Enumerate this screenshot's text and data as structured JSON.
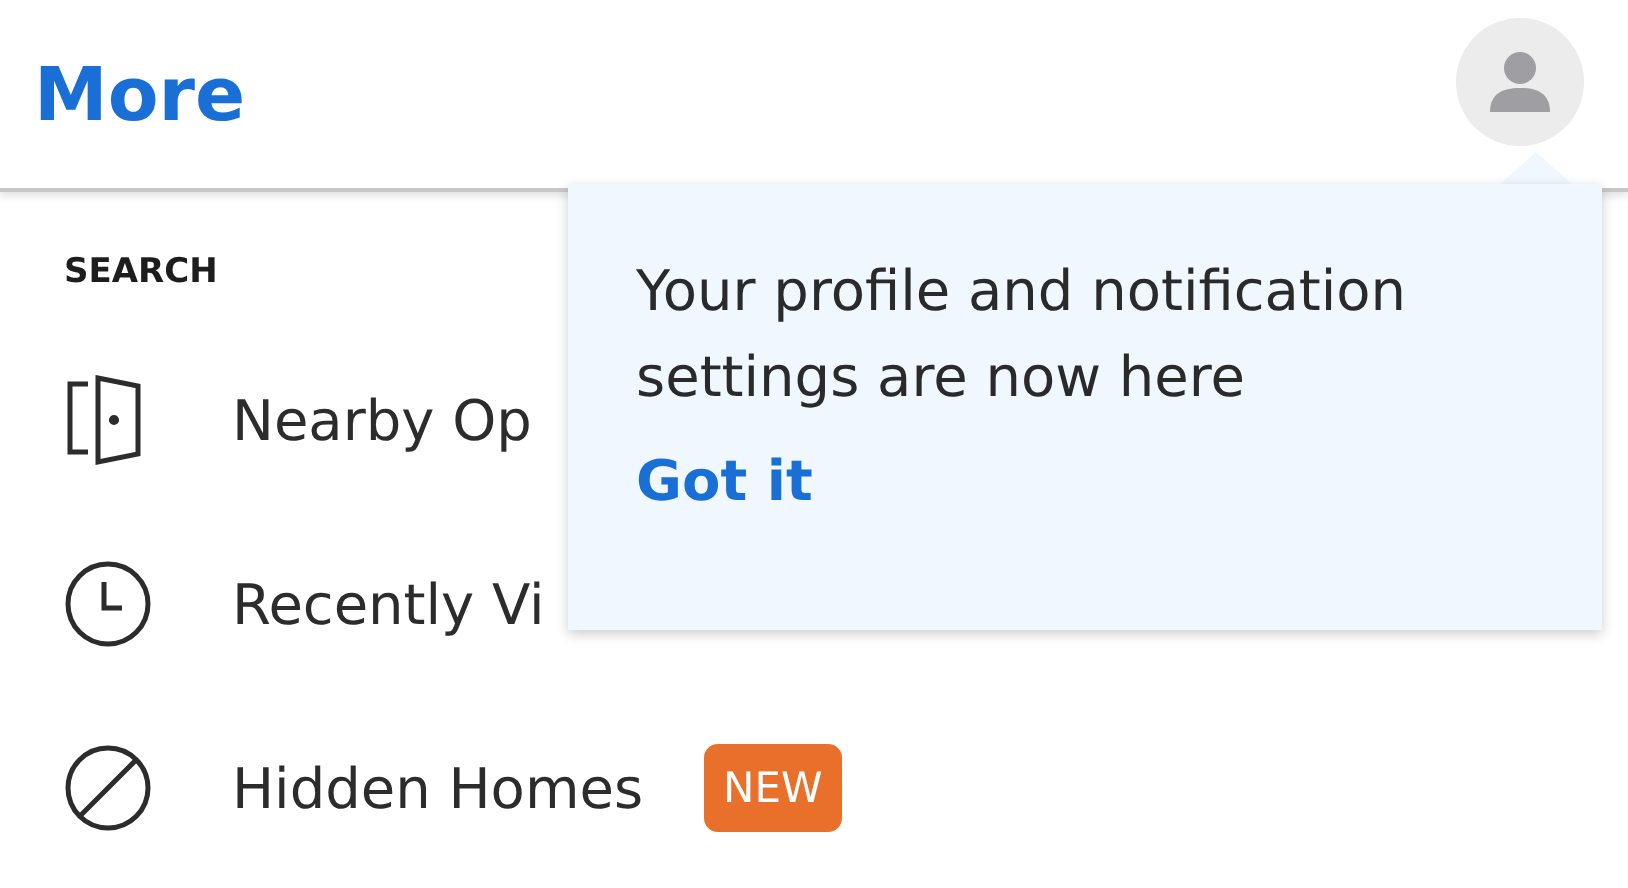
{
  "header": {
    "title": "More"
  },
  "section": {
    "heading": "SEARCH",
    "items": [
      {
        "kind": "door",
        "label": "Nearby Op"
      },
      {
        "kind": "clock",
        "label": "Recently Vi"
      },
      {
        "kind": "hidden",
        "label": "Hidden Homes",
        "badge": "NEW"
      }
    ]
  },
  "popover": {
    "message": "Your profile and notification settings are now here",
    "action": "Got it"
  }
}
